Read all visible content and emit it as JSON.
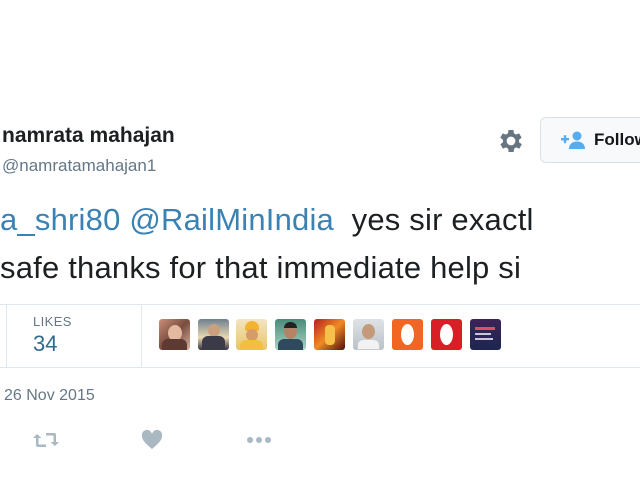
{
  "header": {
    "display_name": "namrata mahajan",
    "handle": "@namratamahajan1",
    "follow_label": "Follow"
  },
  "tweet": {
    "line1_mention1": "a_shri80",
    "line1_mention2": "@RailMinIndia",
    "line1_text": "yes sir exactl",
    "line2_text": "safe thanks for that immediate help si"
  },
  "stats": {
    "likes_label": "LIKES",
    "likes_count": "34"
  },
  "likers": [
    {
      "name": "liker-avatar-1"
    },
    {
      "name": "liker-avatar-2"
    },
    {
      "name": "liker-avatar-3"
    },
    {
      "name": "liker-avatar-4"
    },
    {
      "name": "liker-avatar-5"
    },
    {
      "name": "liker-avatar-6"
    },
    {
      "name": "liker-avatar-7"
    },
    {
      "name": "liker-avatar-8"
    },
    {
      "name": "liker-avatar-9"
    }
  ],
  "meta": {
    "date": "26 Nov 2015"
  },
  "icons": {
    "settings": "gear-icon",
    "follow": "add-person-icon",
    "retweet": "retweet-icon",
    "like": "heart-icon",
    "more": "more-dots-icon"
  },
  "colors": {
    "mention": "#3a82b3",
    "likes_count": "#2f6b8f",
    "muted": "#657786",
    "follow_icon": "#55acee"
  }
}
